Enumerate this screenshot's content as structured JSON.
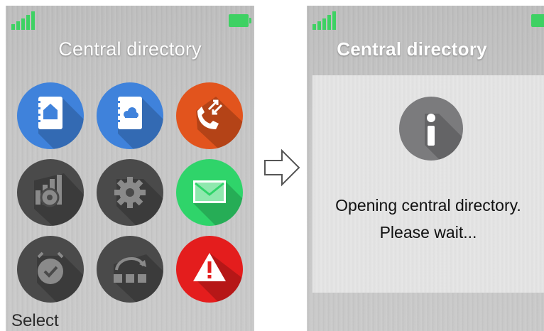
{
  "left_screen": {
    "title": "Central directory",
    "softkey_left": "Select",
    "apps": [
      {
        "name": "local-phonebook",
        "icon": "phonebook-house-icon",
        "color": "#3f82db"
      },
      {
        "name": "central-directory",
        "icon": "phonebook-cloud-icon",
        "color": "#3f82db"
      },
      {
        "name": "call-list",
        "icon": "call-arrows-icon",
        "color": "#e2541d"
      },
      {
        "name": "connections",
        "icon": "signal-gear-icon",
        "color": "#4a4a4a"
      },
      {
        "name": "settings",
        "icon": "gear-icon",
        "color": "#4a4a4a"
      },
      {
        "name": "messages",
        "icon": "envelope-icon",
        "color": "#2fd46a"
      },
      {
        "name": "alarm",
        "icon": "alarm-clock-check-icon",
        "color": "#4a4a4a"
      },
      {
        "name": "profiles",
        "icon": "rotate-squares-icon",
        "color": "#4a4a4a"
      },
      {
        "name": "alerts",
        "icon": "warning-triangle-icon",
        "color": "#e41d1d"
      }
    ]
  },
  "right_screen": {
    "title": "Central directory",
    "dialog": {
      "icon": "info-icon",
      "line1": "Opening central directory.",
      "line2": "Please wait..."
    }
  },
  "transition_arrow": {
    "icon": "right-arrow-icon"
  },
  "colors": {
    "battery": "#3ed163",
    "signal": "#3ed163",
    "title_text": "#ffffff"
  }
}
